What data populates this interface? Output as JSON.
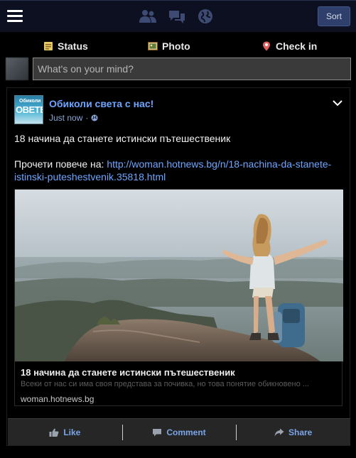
{
  "topbar": {
    "menu_icon": "hamburger-menu-icon",
    "friends_icon": "friends-icon",
    "messages_icon": "messages-icon",
    "notifications_icon": "globe-icon",
    "sort_label": "Sort"
  },
  "composer": {
    "tabs": [
      {
        "label": "Status",
        "icon": "status-note-icon"
      },
      {
        "label": "Photo",
        "icon": "photo-icon"
      },
      {
        "label": "Check in",
        "icon": "location-pin-icon"
      }
    ],
    "placeholder": "What's on your mind?"
  },
  "post": {
    "page_avatar_text_top": "Обиколи",
    "page_avatar_text_main": "ОВЕТЕ",
    "page_name": "Обиколи света с нас!",
    "time": "Just now",
    "separator": "·",
    "privacy_icon": "globe-icon",
    "headline": "18 начина да станете истински пътешественик",
    "read_more_prefix": "Прочети повече на: ",
    "link_url": "http://woman.hotnews.bg/n/18-nachina-da-stanete-istinski-puteshestvenik.35818.html",
    "preview": {
      "title": "18 начина да станете истински пътешественик",
      "description": "Всеки от нас си има своя представа за почивка, но това понятие обикновено ...",
      "domain": "woman.hotnews.bg"
    },
    "actions": {
      "like": "Like",
      "comment": "Comment",
      "share": "Share"
    }
  },
  "colors": {
    "accent_link": "#6ea6ff",
    "action_text": "#7aa6e8",
    "topbar_bg": "#0d1020",
    "sort_button_bg": "#2f3f6b"
  }
}
